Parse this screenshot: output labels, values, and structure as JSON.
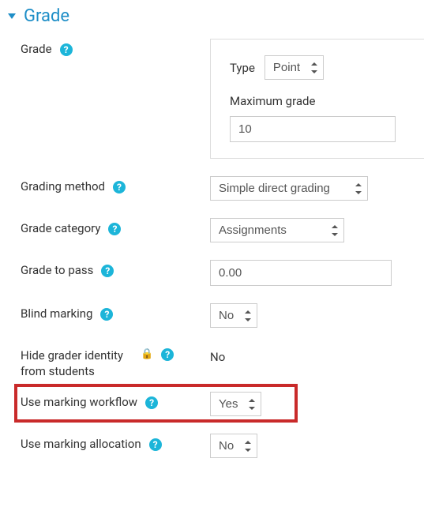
{
  "section": {
    "title": "Grade"
  },
  "grade": {
    "label": "Grade",
    "type_label": "Type",
    "type_value": "Point",
    "max_label": "Maximum grade",
    "max_value": "10"
  },
  "grading_method": {
    "label": "Grading method",
    "value": "Simple direct grading"
  },
  "grade_category": {
    "label": "Grade category",
    "value": "Assignments"
  },
  "grade_to_pass": {
    "label": "Grade to pass",
    "value": "0.00"
  },
  "blind_marking": {
    "label": "Blind marking",
    "value": "No"
  },
  "hide_grader": {
    "label": "Hide grader identity from students",
    "value": "No"
  },
  "marking_workflow": {
    "label": "Use marking workflow",
    "value": "Yes"
  },
  "marking_allocation": {
    "label": "Use marking allocation",
    "value": "No"
  }
}
